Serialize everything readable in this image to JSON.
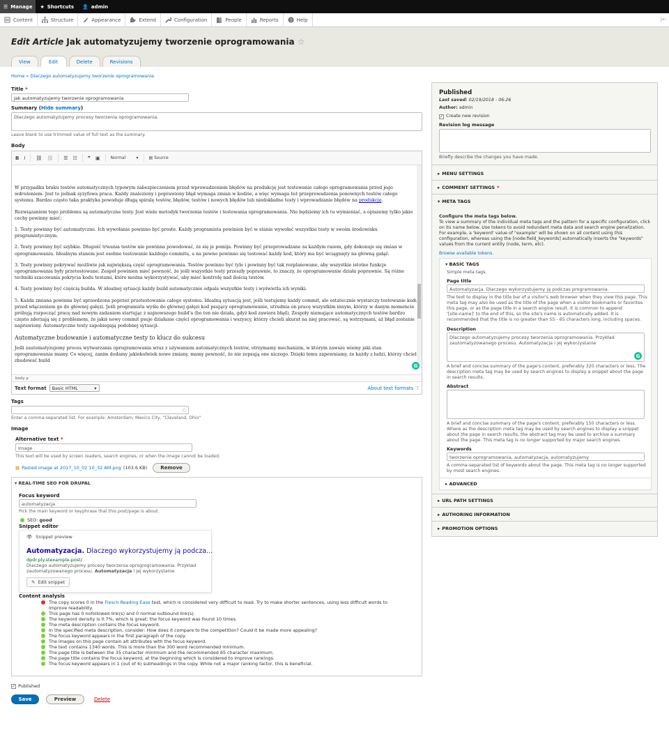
{
  "toolbar": {
    "manage": "Manage",
    "shortcuts": "Shortcuts",
    "user": "admin"
  },
  "tray": {
    "items": [
      "Content",
      "Structure",
      "Appearance",
      "Extend",
      "Configuration",
      "People",
      "Reports",
      "Help"
    ]
  },
  "page": {
    "title_prefix": "Edit Article",
    "title": "Jak automatyzujemy tworzenie oprogramowania",
    "star": "☆"
  },
  "tabs": [
    "View",
    "Edit",
    "Delete",
    "Revisions"
  ],
  "breadcrumb": {
    "home": "Home",
    "sep": "»",
    "current": "Dlaczego automatyzujemy tworzenie oprogramowania"
  },
  "title_field": {
    "label": "Title",
    "required": "*",
    "value": "Jak automatyzujemy tworzenie oprogramowania"
  },
  "summary_field": {
    "label": "Summary",
    "hide_link": "Hide summary",
    "value": "Dlaczego automatyzujemy procesy tworzenia oprogramowania.",
    "help": "Leave blank to use trimmed value of full text as the summary."
  },
  "body": {
    "label": "Body",
    "toolbar": {
      "format": "Normal",
      "source": "Source"
    },
    "paragraphs": [
      "W przypadku braku testów automatycznych typowym zabezpieczeniem przed wprowadzeniem błędów na produkcję jest testowanie całego oprogramowania przed jego wdrożeniem. Jest to jednak syzyfowa praca. Każdy znaleziony i poprawiony błąd wymaga zmian w kodzie, a więc wymaga też przeprowadzenia ponownych testów całego systemu. Bardzo często taka praktyka powoduje długą spiralę testów, błędów, testów i nowych błędów lub niedokładne testy i wprowadzanie błędów na",
      "Rozwiązaniem tego problemu są automatyczne testy. Jest wiele metodyk tworzenia testów i testowania oprogramowania. Nie będziemy ich tu wymieniać, a opiszemy tylko jakie cechy powinny mieć:",
      "1. Testy powinny być automatyczne. Ich wywołanie powinno być proste. Każdy programista powinien być w stanie wywołać wszystkie testy w swoim środowisku programistycznym.",
      "2. Testy powinny być szybkie. Długość trwania testów nie powinna powodować, że się je pomija. Powinny być przeprowadzane za każdym razem, gdy dokonuje się zmian w oprogramowaniu. Idealnym stanem jest osobne testowanie każdego commitu, a na pewno powinno się testować każdy kod, który ma być wciągnięty na główną gałąź.",
      "3. Testy powinny pokrywać możliwie jak największą część oprogramowania. Testów powinno być tyle i powinny być tak rozplanowane, aby wszystkie istotne funkcje oprogramowania były przetestowane. Zespół powinien mieć pewność, że jeśli wszystkie testy przeszły poprawnie, to znaczy, że oprogramowanie działa poprawnie. Są różne techniki szacowania pokrycia kodu testami, które można wykorzystywać, aby mieć kontrolę nad ilością testów.",
      "4. Testy powinny być częścią builda. W idealnej sytuacji każdy build automatycznie odpala wszystkie testy i wyświetla ich wyniki.",
      "5. Każda zmiana powinna być sprawdzona poprzez przetestowanie całego systemu. Idealną sytuacją jest, jeśli testujemy każdy commit, ale ostatecznie wystarczy testowanie kodu przed włączeniem go do głównej gałęzi. Jeśli programista wyśle do głównej gałęzi kod psujący oprogramowanie, utrudnia on pracę wszystkim innym, którzy w danym momencie próbują rozpocząć pracę nad nowym zadaniem startując z najnowszego build'a (bo ten nie działa, gdyż kod zawiera błąd). Zespoły niemające automatycznych testów bardzo często zderzają się z problemem, że jakiś nowy commit psuje działanie części oprogramowania i wszyscy, którzy chcieli akurat na niej pracować, są wstrzymani, aż błąd zostanie naprawiony. Automatyczne testy zapobiegają podobnej sytuacji."
    ],
    "link_text": "produkcję",
    "heading": "Automatyczne budowanie i automatyczne testy to klucz do sukcesu",
    "last_para": "Jeśli zautomatyzujemy proces wytwarzania oprogramowania wraz z używaniem automatycznych testów, otrzymamy mechanizm, w którym zawsze wiemy jaki stan oprogramowania mamy. Co więcej, zanim dodamy jakiekolwiek nowe zmiany, mamy pewność, że nie zepsują one niczego. Dzięki temu zapewniamy, że każdy z ludzi, którzy chcieli zbudować build",
    "path": "body  p",
    "text_format_label": "Text format",
    "text_format_value": "Basic HTML",
    "about_formats": "About text formats"
  },
  "tags": {
    "label": "Tags",
    "help": "Enter a comma-separated list. For example: Amsterdam, Mexico City, \"Cleveland, Ohio\""
  },
  "image": {
    "label": "Image",
    "alt_label": "Alternative text",
    "alt_value": "Image",
    "alt_help": "This text will be used by screen readers, search engines, or when the image cannot be loaded.",
    "file_name": "Pasted image at 2017_10_02 10_32 AM.png",
    "file_size": "(103.6 KB)",
    "remove": "Remove"
  },
  "seo": {
    "heading": "▾ REAL-TIME SEO FOR DRUPAL",
    "focus_label": "Focus keyword",
    "focus_value": "automatyzacja",
    "focus_help": "Pick the main keyword or keyphrase that this post/page is about.",
    "score_label": "SEO:",
    "score_value": "good",
    "snippet_editor": "Snippet editor",
    "snippet_preview": "Snippet preview",
    "snippet_title_bold": "Automatyzacja.",
    "snippet_title_rest": " Dlaczego wykorzystujemy ją podcza...",
    "snippet_url": "dpdr.ply.stexample-post/",
    "snippet_desc_pre": "Dlaczego automatyzujemy procesy tworzenia oprogrogramowania. Przykład zautomatyzowanego procesu. ",
    "snippet_desc_bold": "Automatyzacja",
    "snippet_desc_post": " i jej wykorzystanie",
    "edit_snippet": "Edit snippet",
    "analysis_heading": "Content analysis",
    "analysis_first_pre": "The copy scores 0 in the ",
    "analysis_first_link": "Flesch Reading Ease",
    "analysis_first_post": " test, which is considered very difficult to read. Try to make shorter sentences, using less difficult words to improve readability.",
    "analysis": [
      "This page has 0 nofollowed link(s) and 0 normal outbound link(s).",
      "The keyword density is 0.7%, which is great; the focus keyword was found 10 times.",
      "The meta description contains the focus keyword.",
      "In the specified meta description, consider: How does it compare to the competition? Could it be made more appealing?",
      "The focus keyword appears in the first paragraph of the copy.",
      "The images on this page contain alt attributes with the focus keyword.",
      "The text contains 1340 words. This is more than the 300 word recommended minimum.",
      "The page title is between the 35 character minimum and the recommended 65 character maximum.",
      "The page title contains the focus keyword, at the beginning which is considered to improve rankings.",
      "The focus keyword appears in 1 (out of 4) subheadings in the copy. While not a major ranking factor, this is beneficial."
    ],
    "colors": {
      "bad": "#dc3232",
      "good": "#7ad03a"
    }
  },
  "bottom": {
    "published": "Published",
    "save": "Save",
    "preview": "Preview",
    "delete": "Delete"
  },
  "sidebar": {
    "status": "Published",
    "last_saved_label": "Last saved:",
    "last_saved": "02/19/2018 - 06:26",
    "author_label": "Author:",
    "author": "admin",
    "new_revision": "Create new revision",
    "revlog_label": "Revision log message",
    "revlog_help": "Briefly describe the changes you have made.",
    "menu": "MENU SETTINGS",
    "comment": "COMMENT SETTINGS",
    "meta": "META TAGS",
    "meta_intro_bold": "Configure the meta tags below.",
    "meta_intro": "To view a summary of the individual meta tags and the pattern for a specific configuration, click on its name below. Use tokens to avoid redundant meta data and search engine penalization. For example, a 'keyword' value of \"example\" will be shown on all content using this configuration, whereas using the [node:field_keywords] automatically inserts the \"keywords\" values from the current entity (node, term, etc).",
    "browse_tokens": "Browse available tokens.",
    "basic_tags": "BASIC TAGS",
    "basic_desc": "Simple meta tags.",
    "page_title_label": "Page title",
    "page_title_value": "Automatyzacja. Dlaczego wykorzystujemy ją podczas programowania.",
    "page_title_help": "The text to display in the title bar of a visitor's web browser when they view this page. This meta tag may also be used as the title of the page when a visitor bookmarks or favorites this page, or as the page title in a search engine result. It is common to append '[site:name]' to the end of this, so the site's name is automatically added. It is recommended that the title is no greater than 55 - 65 characters long, including spaces.",
    "description_label": "Description",
    "description_value": "Dlaczego automatyzujemy procesy tworzenia oprogramowania. Przykład zautomatyzowanego procesu. Automatyzacja i jej wykorzystanie",
    "description_help": "A brief and concise summary of the page's content, preferably 320 characters or less. The description meta tag may be used by search engines to display a snippet about the page in search results.",
    "abstract_label": "Abstract",
    "abstract_help_pre": "A brief and concise summary of the page's content, preferably 150 characters or less. Where as the description meta tag may be used by search engines to display a snippet about the page in search results, the abstract tag may be used to archive a summary about the page. This meta tag is ",
    "abstract_help_em": "no longer",
    "abstract_help_post": " supported by major search engines.",
    "keywords_label": "Keywords",
    "keywords_value": "tworzenie oprogramowania, automatyzacja, automatyzujemy",
    "keywords_help_pre": "A comma-separated list of keywords about the page. This meta tag is ",
    "keywords_help_em": "no longer",
    "keywords_help_post": " supported by most search engines.",
    "advanced": "ADVANCED",
    "url_path": "URL PATH SETTINGS",
    "authoring": "AUTHORING INFORMATION",
    "promotion": "PROMOTION OPTIONS"
  }
}
